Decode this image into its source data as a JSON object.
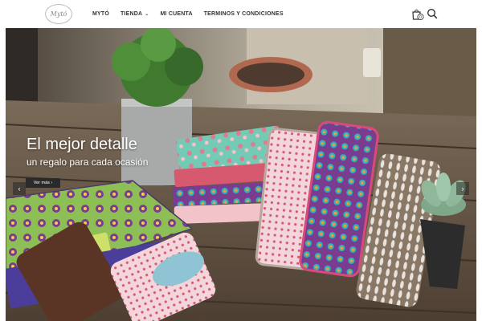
{
  "brand": {
    "logo_text": "Mytó"
  },
  "nav": {
    "items": [
      {
        "label": "MYTÓ"
      },
      {
        "label": "TIENDA",
        "has_dropdown": true
      },
      {
        "label": "MI CUENTA"
      },
      {
        "label": "TERMINOS Y CONDICIONES"
      }
    ]
  },
  "header_icons": {
    "cart_icon": "shopping-bag-icon",
    "cart_count": "0",
    "search_icon": "search-icon"
  },
  "hero": {
    "title": "El mejor detalle",
    "subtitle": "un regalo para cada ocasión",
    "cta_label": "Ver más ›",
    "prev_label": "‹",
    "next_label": "›"
  }
}
